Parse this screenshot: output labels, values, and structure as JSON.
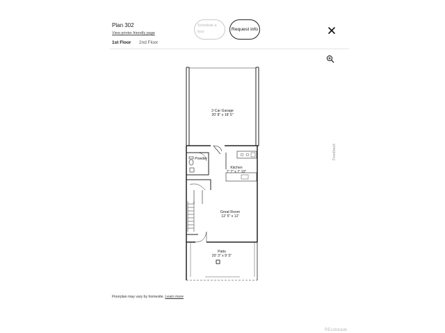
{
  "header": {
    "plan_title": "Plan 302",
    "printer_link": "View printer friendly page",
    "schedule_label": "Schedule a tour",
    "request_label": "Request info"
  },
  "floor_tabs": [
    {
      "label": "1st Floor",
      "active": true
    },
    {
      "label": "2nd Floor",
      "active": false
    }
  ],
  "floorplan": {
    "rooms": [
      {
        "name": "2-Car Garage",
        "dims": "20' 8\" x 18' 5\""
      },
      {
        "name": "Powder",
        "dims": ""
      },
      {
        "name": "Kitchen",
        "dims": "7' 7\" x 7' 10\""
      },
      {
        "name": "Great Room",
        "dims": "12' 5\" x 12'"
      },
      {
        "name": "Patio",
        "dims": "20' 3\" x 9' 5\""
      }
    ]
  },
  "feedback_label": "Feedback",
  "footer": {
    "disclaimer": "Floorplan may vary by homesite.",
    "learn_more": "Learn more",
    "brand": "REcolorado"
  },
  "icons": {
    "close": "close-icon",
    "zoom": "zoom-in-icon"
  },
  "colors": {
    "text": "#1a1a1a",
    "muted": "#b8b8b8",
    "line": "#222222"
  }
}
